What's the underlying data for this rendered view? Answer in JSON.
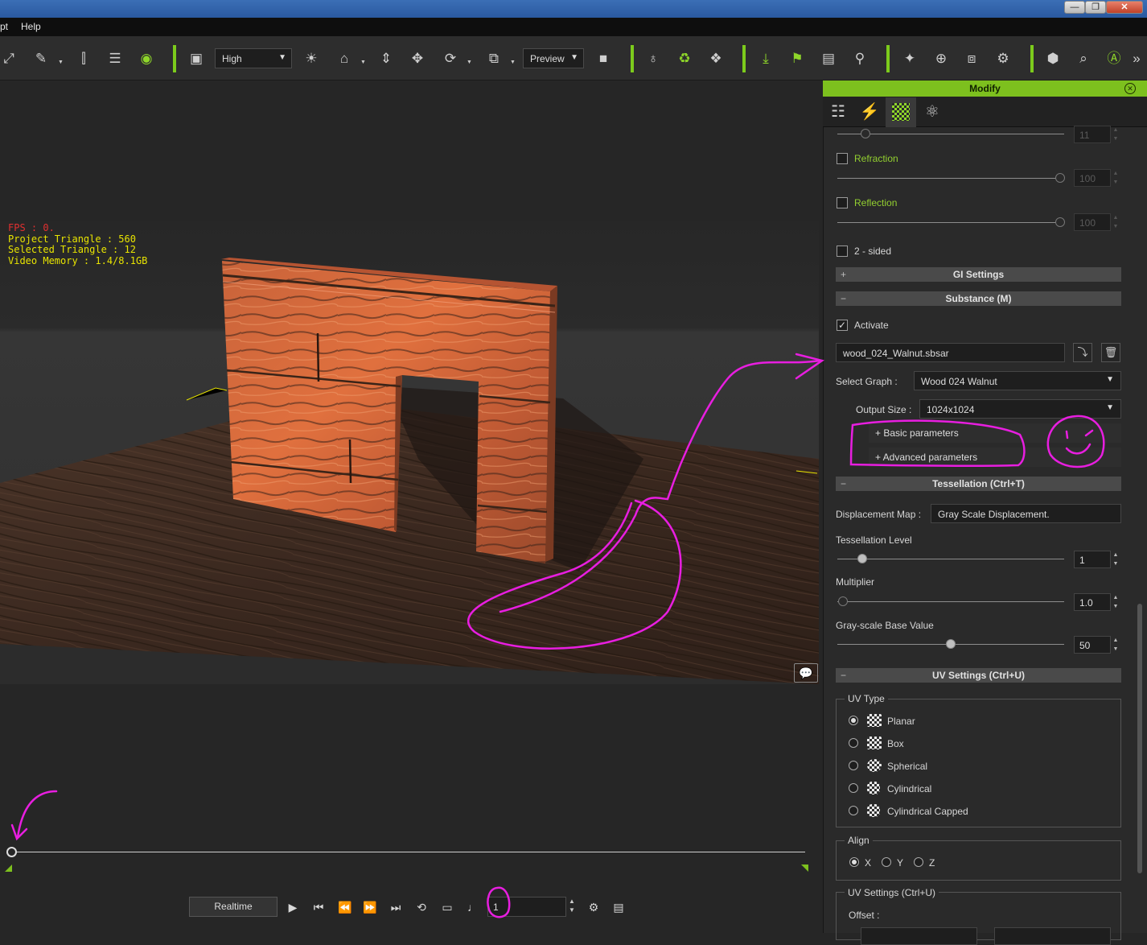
{
  "menu": {
    "items": [
      "pt",
      "Help"
    ]
  },
  "window_buttons": [
    "—",
    "❐",
    "✕"
  ],
  "toolbar": {
    "quality_select": "High",
    "preview_select": "Preview",
    "overflow": "»"
  },
  "viewport": {
    "hud_fps": "FPS : 0.",
    "hud_project_triangle": "Project Triangle : 560",
    "hud_selected_triangle": "Selected Triangle : 12",
    "hud_video_memory": "Video Memory : 1.4/8.1GB"
  },
  "playback": {
    "realtime_label": "Realtime",
    "frame_value": "1"
  },
  "panel": {
    "title": "Modify",
    "refraction": {
      "label": "Refraction",
      "value": "100",
      "checked": false
    },
    "reflection": {
      "label": "Reflection",
      "value": "100",
      "checked": false
    },
    "top_partial_value": "11",
    "two_sided": {
      "label": "2 - sided",
      "checked": false
    },
    "gi_settings": {
      "label": "GI Settings",
      "expander": "+"
    },
    "substance": {
      "label": "Substance (M)",
      "expander": "−",
      "activate_label": "Activate",
      "activate_checked": true,
      "file_name": "wood_024_Walnut.sbsar",
      "select_graph_label": "Select Graph :",
      "select_graph_value": "Wood 024 Walnut",
      "output_size_label": "Output Size :",
      "output_size_value": "1024x1024",
      "basic_parameters": "+  Basic parameters",
      "advanced_parameters": "+  Advanced parameters"
    },
    "tessellation": {
      "label": "Tessellation  (Ctrl+T)",
      "expander": "−",
      "displacement_map_label": "Displacement Map :",
      "displacement_map_value": "Gray Scale Displacement.",
      "level_label": "Tessellation Level",
      "level_value": "1",
      "multiplier_label": "Multiplier",
      "multiplier_value": "1.0",
      "gray_base_label": "Gray-scale Base Value",
      "gray_base_value": "50"
    },
    "uv_settings": {
      "label": "UV Settings  (Ctrl+U)",
      "expander": "−",
      "uv_type_label": "UV Type",
      "uv_types": [
        "Planar",
        "Box",
        "Spherical",
        "Cylindrical",
        "Cylindrical Capped"
      ],
      "uv_selected": "Planar",
      "align_label": "Align",
      "align_options": [
        "X",
        "Y",
        "Z"
      ],
      "align_selected": "X",
      "group2_label": "UV Settings  (Ctrl+U)",
      "offset_label": "Offset :"
    }
  },
  "colors": {
    "accent_green": "#7dc01e",
    "annotation_magenta": "#e81ee0",
    "hud_yellow": "#e8e400",
    "hud_red": "#e23030"
  }
}
